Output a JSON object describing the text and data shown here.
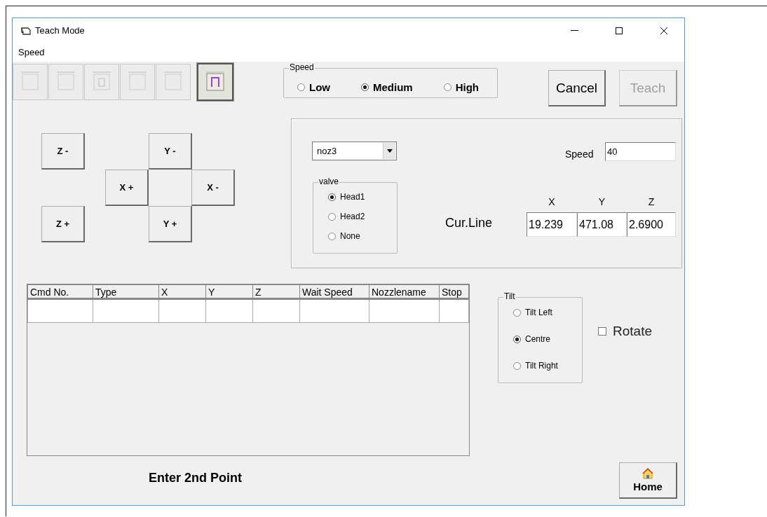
{
  "window": {
    "title": "Teach Mode"
  },
  "menu": [
    "Speed"
  ],
  "toolbar": [
    {
      "selected": false
    },
    {
      "selected": false
    },
    {
      "selected": false
    },
    {
      "selected": false
    },
    {
      "selected": false
    },
    {
      "selected": true
    }
  ],
  "speed_group": {
    "label": "Speed",
    "options": [
      {
        "label": "Low",
        "selected": false
      },
      {
        "label": "Medium",
        "selected": true
      },
      {
        "label": "High",
        "selected": false
      }
    ]
  },
  "buttons": [
    {
      "label": "Cancel",
      "disabled": false
    },
    {
      "label": "Teach",
      "disabled": true
    }
  ],
  "jog_buttons": [
    "Z -",
    "Y -",
    "X +",
    "X -",
    "Z +",
    "Y +"
  ],
  "nozzle_select": {
    "value": "noz3"
  },
  "valve": {
    "label": "valve",
    "options": [
      {
        "label": "Head1",
        "selected": true
      },
      {
        "label": "Head2",
        "selected": false
      },
      {
        "label": "None",
        "selected": false
      }
    ]
  },
  "speed_field": {
    "label": "Speed",
    "value": "40"
  },
  "cur_line": {
    "label": "Cur.Line",
    "axes": [
      {
        "label": "X",
        "value": "19.239"
      },
      {
        "label": "Y",
        "value": "471.08"
      },
      {
        "label": "Z",
        "value": "2.6900"
      }
    ]
  },
  "table": {
    "columns": [
      "Cmd No.",
      "Type",
      "X",
      "Y",
      "Z",
      "Wait  Speed",
      "Nozzlename",
      "Stop"
    ]
  },
  "tilt": {
    "label": "Tilt",
    "options": [
      {
        "label": "Tilt Left",
        "selected": false
      },
      {
        "label": "Centre",
        "selected": true
      },
      {
        "label": "Tilt Right",
        "selected": false
      }
    ]
  },
  "rotate": {
    "label": "Rotate",
    "checked": false
  },
  "status": "Enter 2nd Point",
  "home_button": {
    "label": "Home"
  }
}
